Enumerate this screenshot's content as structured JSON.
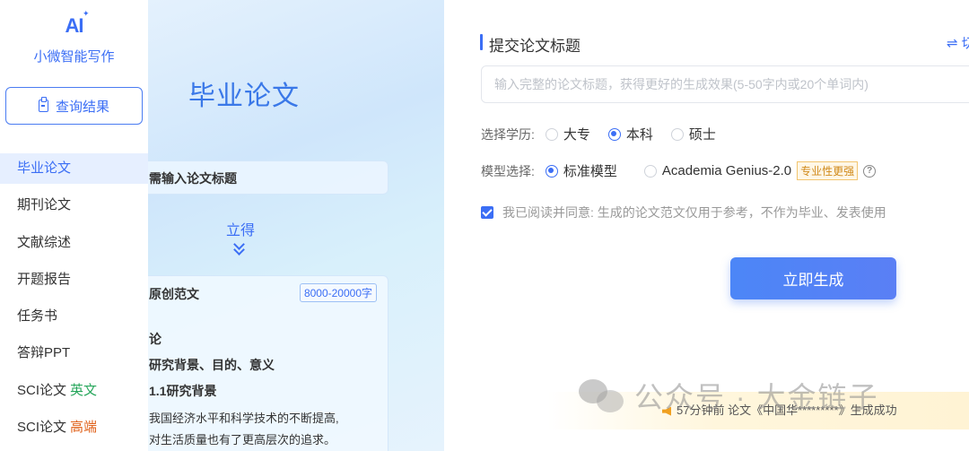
{
  "brand": {
    "logo_mark": "AI",
    "name": "小微智能写作"
  },
  "sidebar": {
    "query_button": "查询结果",
    "items": [
      {
        "label": "毕业论文",
        "tag": "",
        "active": true
      },
      {
        "label": "期刊论文",
        "tag": ""
      },
      {
        "label": "文献综述",
        "tag": ""
      },
      {
        "label": "开题报告",
        "tag": ""
      },
      {
        "label": "任务书",
        "tag": ""
      },
      {
        "label": "答辩PPT",
        "tag": ""
      },
      {
        "label": "SCI论文",
        "tag": "英文",
        "tag_color": "#26a65b"
      },
      {
        "label": "SCI论文",
        "tag": "高端",
        "tag_color": "#e0621b"
      }
    ]
  },
  "preview": {
    "title": "毕业论文",
    "step_text": "需输入论文标题",
    "arrow_label": "立得",
    "doc": {
      "heading": "原创范文",
      "badge": "8000-20000字",
      "line1": "论",
      "line2": "研究背景、目的、意义",
      "line3": "1.1研究背景",
      "para1": "我国经济水平和科学技术的不断提高,",
      "para2": "对生活质量也有了更高层次的追求。"
    }
  },
  "form": {
    "title": "提交论文标题",
    "switch_label": "⇌ 切",
    "input_placeholder": "输入完整的论文标题，获得更好的生成效果(5-50字内或20个单词内)",
    "education": {
      "label": "选择学历:",
      "options": [
        "大专",
        "本科",
        "硕士"
      ],
      "selected": "本科"
    },
    "model": {
      "label": "模型选择:",
      "options": [
        "标准模型",
        "Academia Genius-2.0"
      ],
      "selected": "标准模型",
      "pro_tag": "专业性更强",
      "help": "?"
    },
    "agreement": "我已阅读并同意: 生成的论文范文仅用于参考，不作为毕业、发表使用",
    "agreement_checked": true,
    "generate_button": "立即生成"
  },
  "notice": {
    "text": "57分钟前 论文《中国华*********》生成成功"
  },
  "watermark": {
    "text": "公众号 · 大金链子"
  },
  "colors": {
    "accent": "#3b6ef5",
    "success": "#26a65b",
    "warning": "#e0621b"
  }
}
